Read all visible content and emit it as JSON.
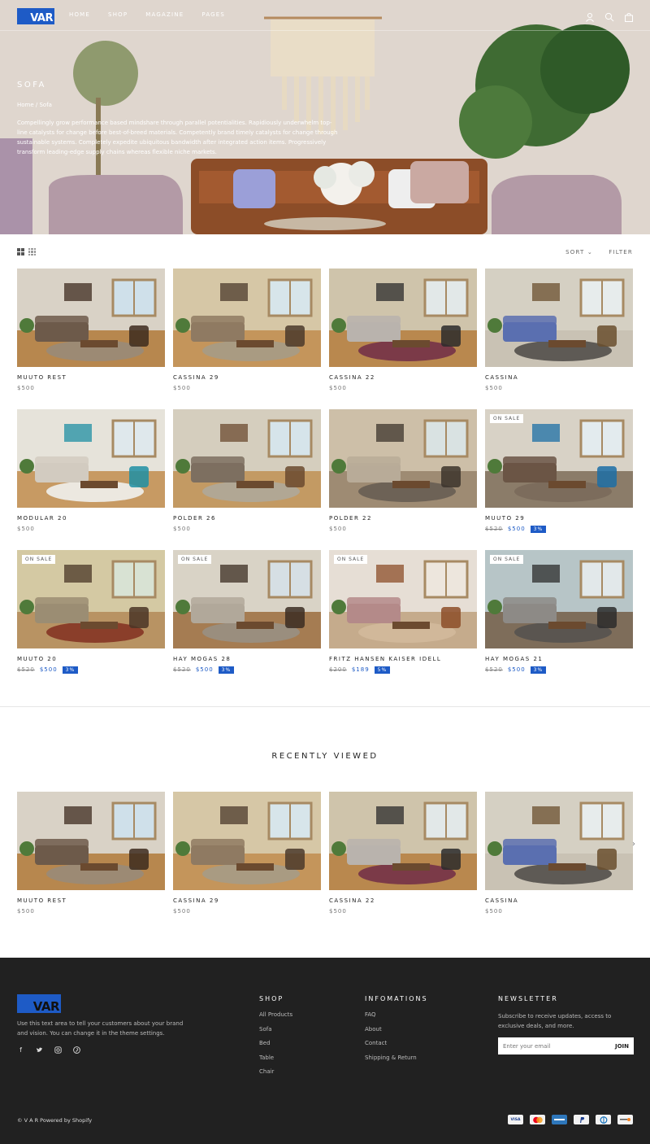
{
  "header": {
    "logo": "VAR",
    "nav": [
      "HOME",
      "SHOP",
      "MAGAZINE",
      "PAGES"
    ],
    "icons": [
      "account-icon",
      "search-icon",
      "cart-icon"
    ]
  },
  "hero": {
    "title": "SOFA",
    "breadcrumb": "Home / Sofa",
    "description": "Compellingly grow performance based mindshare through parallel potentialities. Rapidiously underwhelm top-line catalysts for change before best-of-breed materials. Competently brand timely catalysts for change through sustainable systems. Completely expedite ubiquitous bandwidth after integrated action items. Progressively transform leading-edge supply chains whereas flexible niche markets."
  },
  "toolbar": {
    "sort_label": "SORT",
    "filter_label": "FILTER"
  },
  "products": [
    {
      "name": "MUUTO REST",
      "price": "$500"
    },
    {
      "name": "CASSINA 29",
      "price": "$500"
    },
    {
      "name": "CASSINA 22",
      "price": "$500"
    },
    {
      "name": "CASSINA",
      "price": "$500"
    },
    {
      "name": "MODULAR 20",
      "price": "$500"
    },
    {
      "name": "POLDER 26",
      "price": "$500"
    },
    {
      "name": "POLDER 22",
      "price": "$500"
    },
    {
      "name": "MUUTO 29",
      "badge": "ON SALE",
      "old_price": "$520",
      "price": "$500",
      "discount": "3%"
    },
    {
      "name": "MUUTO 20",
      "badge": "ON SALE",
      "old_price": "$520",
      "price": "$500",
      "discount": "3%"
    },
    {
      "name": "HAY MOGAS 28",
      "badge": "ON SALE",
      "old_price": "$520",
      "price": "$500",
      "discount": "3%"
    },
    {
      "name": "FRITZ HANSEN KAISER IDELL",
      "badge": "ON SALE",
      "old_price": "$200",
      "price": "$189",
      "discount": "5%"
    },
    {
      "name": "HAY MOGAS 21",
      "badge": "ON SALE",
      "old_price": "$520",
      "price": "$500",
      "discount": "3%"
    }
  ],
  "recently_viewed": {
    "title": "RECENTLY VIEWED",
    "items": [
      {
        "name": "MUUTO REST",
        "price": "$500"
      },
      {
        "name": "CASSINA 29",
        "price": "$500"
      },
      {
        "name": "CASSINA 22",
        "price": "$500"
      },
      {
        "name": "CASSINA",
        "price": "$500"
      }
    ]
  },
  "footer": {
    "logo": "VAR",
    "about": "Use this text area to tell your customers about your brand and vision. You can change it in the theme settings.",
    "social": [
      "facebook-icon",
      "twitter-icon",
      "instagram-icon",
      "pinterest-icon"
    ],
    "shop": {
      "title": "SHOP",
      "links": [
        "All Products",
        "Sofa",
        "Bed",
        "Table",
        "Chair"
      ]
    },
    "info": {
      "title": "INFOMATIONS",
      "links": [
        "FAQ",
        "About",
        "Contact",
        "Shipping & Return"
      ]
    },
    "newsletter": {
      "title": "NEWSLETTER",
      "description": "Subscribe to receive updates, access to exclusive deals, and more.",
      "placeholder": "Enter your email",
      "button": "JOIN"
    },
    "copyright": "©  V A R  Powered by Shopify",
    "payments": [
      "VISA",
      "MC",
      "AMEX",
      "PP",
      "DC",
      "DISC"
    ]
  },
  "colors": {
    "accent": "#1e5bc6",
    "footer_bg": "#212121"
  }
}
